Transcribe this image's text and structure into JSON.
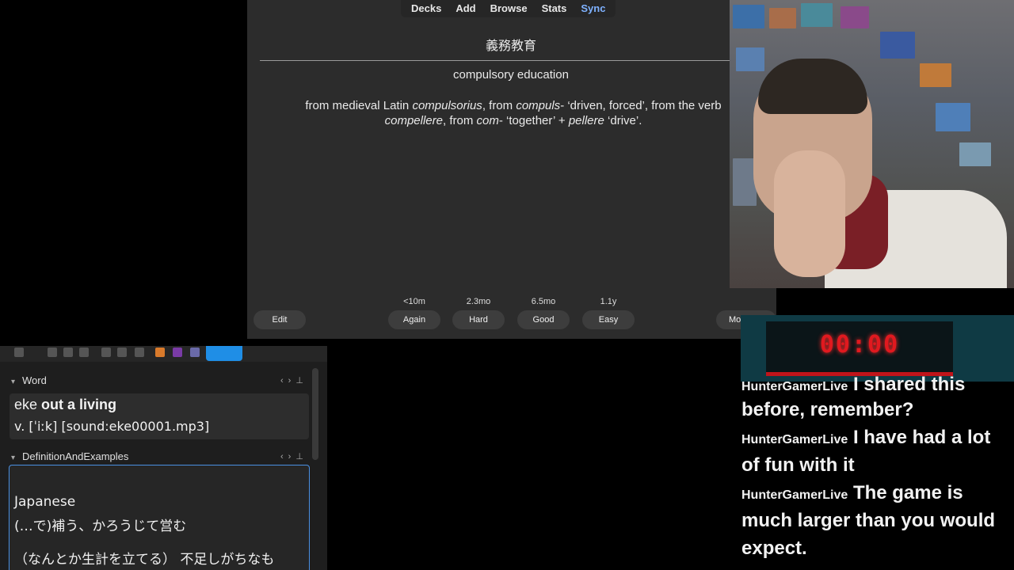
{
  "nav": {
    "tabs": [
      "Decks",
      "Add",
      "Browse",
      "Stats",
      "Sync"
    ]
  },
  "card": {
    "front": "義務教育",
    "back": "compulsory education",
    "etymology": {
      "parts": [
        {
          "t": "from medieval Latin "
        },
        {
          "t": "compulsorius",
          "i": true
        },
        {
          "t": ", from "
        },
        {
          "t": "compuls",
          "i": true
        },
        {
          "t": "- ‘driven, forced’, from the verb "
        },
        {
          "t": "compellere",
          "i": true
        },
        {
          "t": ", from "
        },
        {
          "t": "com",
          "i": true
        },
        {
          "t": "- ‘together’ + "
        },
        {
          "t": "pellere",
          "i": true
        },
        {
          "t": " ‘drive’."
        }
      ]
    }
  },
  "answer_buttons": [
    {
      "interval": "<10m",
      "label": "Again"
    },
    {
      "interval": "2.3mo",
      "label": "Hard"
    },
    {
      "interval": "6.5mo",
      "label": "Good"
    },
    {
      "interval": "1.1y",
      "label": "Easy"
    }
  ],
  "edit_label": "Edit",
  "more_label": "Mo",
  "editor": {
    "word_field": "Word",
    "word_line1_plain": "eke ",
    "word_line1_bold": "out a living",
    "word_line2": "v. [ˈiːk] [sound:eke00001.mp3]",
    "def_field": "DefinitionAndExamples",
    "def_lines": [
      "Japanese",
      "(…で)補う、かろうじて営む",
      "（なんとか生計を立てる） 不足しがちなも"
    ]
  },
  "timer": "00:00",
  "chat": {
    "lines": [
      {
        "user": "HunterGamerLive",
        "text": "I shared this"
      },
      {
        "user": "",
        "text": "before, remember?"
      },
      {
        "user": "HunterGamerLive",
        "text": "I have had a lot"
      },
      {
        "user": "",
        "text": "of fun with it"
      },
      {
        "user": "HunterGamerLive",
        "text": "The game is"
      },
      {
        "user": "",
        "text": "much larger than you would"
      },
      {
        "user": "",
        "text": "expect."
      }
    ]
  }
}
